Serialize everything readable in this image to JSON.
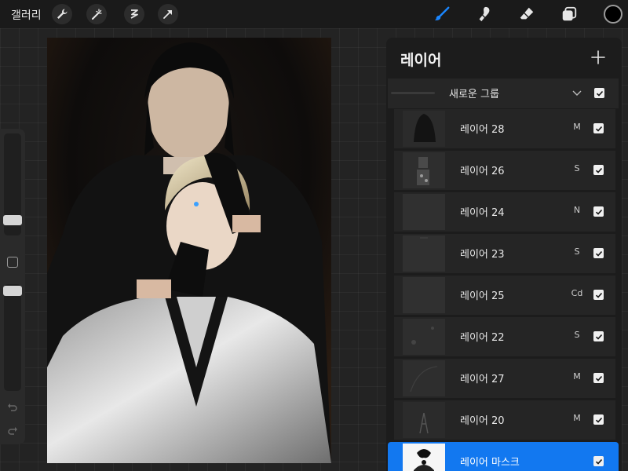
{
  "topbar": {
    "gallery_label": "갤러리",
    "left_tools": [
      "wrench-icon",
      "magic-wand-icon",
      "selection-s-icon",
      "transform-arrow-icon"
    ],
    "right_tools": [
      "brush-icon",
      "smudge-icon",
      "eraser-icon",
      "layers-icon"
    ],
    "active_tool": "brush-icon",
    "active_color": "#000000",
    "accent": "#1278f0"
  },
  "sidebar": {
    "brush_size_level": 0.18,
    "opacity_level": 0.78
  },
  "layers_panel": {
    "title": "레이어",
    "add_icon": "plus-icon",
    "group": {
      "name": "새로운 그룹",
      "visible": true,
      "expanded": true
    },
    "layers": [
      {
        "name": "레이어 28",
        "mode": "M",
        "visible": true
      },
      {
        "name": "레이어 26",
        "mode": "S",
        "visible": true
      },
      {
        "name": "레이어 24",
        "mode": "N",
        "visible": true
      },
      {
        "name": "레이어 23",
        "mode": "S",
        "visible": true
      },
      {
        "name": "레이어 25",
        "mode": "Cd",
        "visible": true
      },
      {
        "name": "레이어 22",
        "mode": "S",
        "visible": true
      },
      {
        "name": "레이어 27",
        "mode": "M",
        "visible": true
      },
      {
        "name": "레이어 20",
        "mode": "M",
        "visible": true
      },
      {
        "name": "레이어 마스크",
        "mode": "",
        "visible": true,
        "selected": true
      }
    ]
  }
}
